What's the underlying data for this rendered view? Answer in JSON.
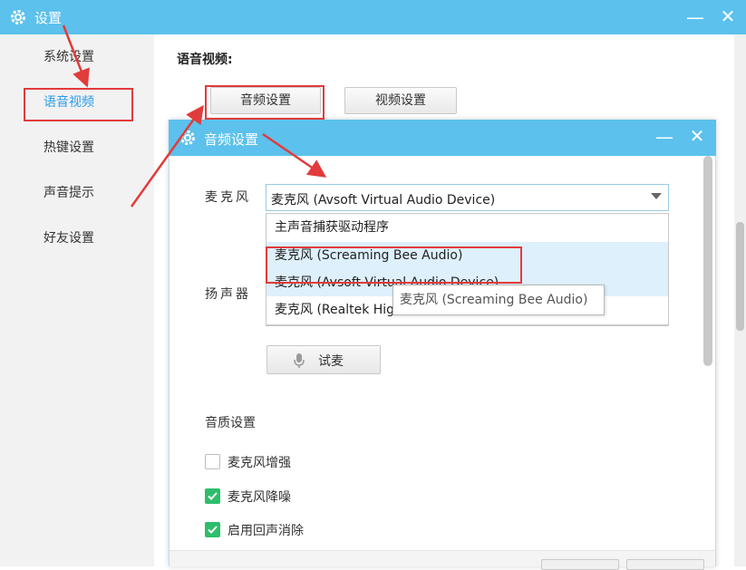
{
  "window": {
    "title": "设置"
  },
  "sidebar": {
    "items": [
      {
        "label": "系统设置",
        "active": false
      },
      {
        "label": "语音视频",
        "active": true
      },
      {
        "label": "热键设置",
        "active": false
      },
      {
        "label": "声音提示",
        "active": false
      },
      {
        "label": "好友设置",
        "active": false
      }
    ]
  },
  "main": {
    "section_title": "语音视频:",
    "tabs": [
      {
        "label": "音频设置"
      },
      {
        "label": "视频设置"
      }
    ]
  },
  "dialog": {
    "title": "音频设置",
    "mic_label": "麦克风",
    "mic_selected": "麦克风 (Avsoft Virtual Audio Device)",
    "mic_options": [
      "主声音捕获驱动程序",
      "麦克风 (Screaming Bee Audio)",
      "麦克风 (Avsoft Virtual Audio Device)",
      "麦克风 (Realtek High Definition Audio)"
    ],
    "speaker_label": "扬声器",
    "test_button": "试麦",
    "tooltip": "麦克风 (Screaming Bee Audio)",
    "quality_title": "音质设置",
    "checkboxes": [
      {
        "label": "麦克风增强",
        "checked": false
      },
      {
        "label": "麦克风降噪",
        "checked": true
      },
      {
        "label": "启用回声消除",
        "checked": true
      }
    ]
  },
  "colors": {
    "titlebar": "#5cc1ec",
    "accent_blue": "#2a9be6",
    "annotation_red": "#e23b3b",
    "checkbox_green": "#2ebd6b"
  }
}
